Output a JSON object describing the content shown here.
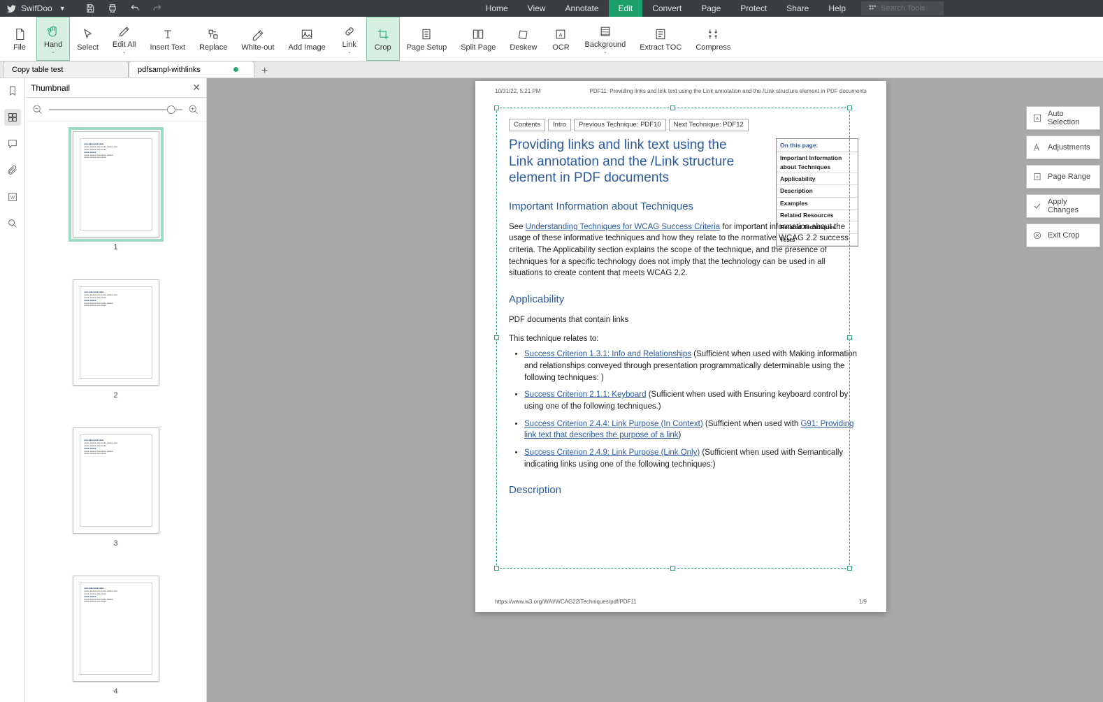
{
  "app": {
    "name": "SwifDoo"
  },
  "titlebar_menus": [
    "Home",
    "View",
    "Annotate",
    "Edit",
    "Convert",
    "Page",
    "Protect",
    "Share",
    "Help"
  ],
  "titlebar_active": "Edit",
  "search_placeholder": "Search Tools",
  "ribbon": [
    {
      "label": "File",
      "dd": false
    },
    {
      "label": "Hand",
      "dd": true,
      "active": true
    },
    {
      "label": "Select",
      "dd": false
    },
    {
      "label": "Edit All",
      "dd": true
    },
    {
      "label": "Insert Text",
      "dd": false
    },
    {
      "label": "Replace",
      "dd": false
    },
    {
      "label": "White-out",
      "dd": false
    },
    {
      "label": "Add Image",
      "dd": false
    },
    {
      "label": "Link",
      "dd": true
    },
    {
      "label": "Crop",
      "dd": false,
      "active": true
    },
    {
      "label": "Page Setup",
      "dd": false
    },
    {
      "label": "Split Page",
      "dd": false
    },
    {
      "label": "Deskew",
      "dd": false
    },
    {
      "label": "OCR",
      "dd": false
    },
    {
      "label": "Background",
      "dd": true
    },
    {
      "label": "Extract TOC",
      "dd": false
    },
    {
      "label": "Compress",
      "dd": false
    }
  ],
  "doctabs": [
    {
      "label": "Copy table test",
      "active": false
    },
    {
      "label": "pdfsampl-withlinks",
      "active": true,
      "modified": true
    }
  ],
  "thumbpanel": {
    "title": "Thumbnail"
  },
  "thumbs": [
    {
      "num": "1",
      "selected": true
    },
    {
      "num": "2"
    },
    {
      "num": "3"
    },
    {
      "num": "4"
    }
  ],
  "rightactions": [
    {
      "label": "Auto Selection",
      "icon": "auto"
    },
    {
      "label": "Adjustments",
      "icon": "adj"
    },
    {
      "label": "Page Range",
      "icon": "range"
    },
    {
      "label": "Apply Changes",
      "icon": "apply"
    },
    {
      "label": "Exit Crop",
      "icon": "exit"
    }
  ],
  "pageheader": {
    "left": "10/31/22, 5:21 PM",
    "right": "PDF11: Providing links and link text using the Link annotation and the /Link structure element in PDF documents"
  },
  "pagefooter": {
    "left": "https://www.w3.org/WAI/WCAG22/Techniques/pdf/PDF11",
    "right": "1/9"
  },
  "doc": {
    "navbtns": [
      "Contents",
      "Intro",
      "Previous Technique: PDF10",
      "Next Technique: PDF12"
    ],
    "title": "Providing links and link text using the Link annotation and the /Link structure element in PDF documents",
    "toc_header": "On this page:",
    "toc_items": [
      "Important Information about Techniques",
      "Applicability",
      "Description",
      "Examples",
      "Related Resources",
      "Related Techniques",
      "Tests"
    ],
    "h2_important": "Important Information about Techniques",
    "para_see_pre": "See ",
    "para_see_link": "Understanding Techniques for WCAG Success Criteria",
    "para_see_post": " for important information about the usage of these informative techniques and how they relate to the normative WCAG 2.2 success criteria. The Applicability section explains the scope of the technique, and the presence of techniques for a specific technology does not imply that the technology can be used in all situations to create content that meets WCAG 2.2.",
    "h2_applicability": "Applicability",
    "para_pdf": "PDF documents that contain links",
    "para_relates": "This technique relates to:",
    "li1_link": "Success Criterion 1.3.1: Info and Relationships",
    "li1_post": " (Sufficient when used with Making information and relationships conveyed through presentation programmatically determinable using the following techniques: )",
    "li2_link": "Success Criterion 2.1.1: Keyboard",
    "li2_post": " (Sufficient when used with Ensuring keyboard control by using one of the following techniques.)",
    "li3_link": "Success Criterion 2.4.4: Link Purpose (In Context)",
    "li3_mid": " (Sufficient when used with ",
    "li3_link2": "G91: Providing link text that describes the purpose of a link",
    "li3_post": ")",
    "li4_link": "Success Criterion 2.4.9: Link Purpose (Link Only)",
    "li4_post": " (Sufficient when used with Semantically indicating links using one of the following techniques:)",
    "h2_description": "Description"
  }
}
